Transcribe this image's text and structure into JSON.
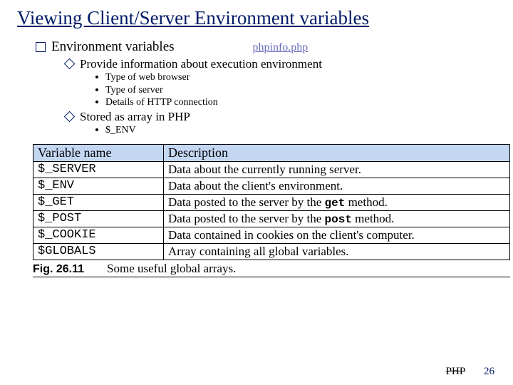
{
  "title": "Viewing Client/Server Environment variables",
  "bullet1": "Environment variables",
  "link": "phpinfo.php",
  "sub1": "Provide information about execution environment",
  "sub1a": "Type of web browser",
  "sub1b": "Type of server",
  "sub1c": "Details of HTTP connection",
  "sub2": "Stored as array in PHP",
  "sub2a": "$_ENV",
  "th1": "Variable name",
  "th2": "Description",
  "rows": [
    {
      "n": "$_SERVER",
      "d": "Data about the currently running server."
    },
    {
      "n": "$_ENV",
      "d": "Data about the client's environment."
    },
    {
      "n": "$_GET",
      "d0": "Data posted to the server by the ",
      "m": "get",
      "d1": " method."
    },
    {
      "n": "$_POST",
      "d0": "Data posted to the server by the ",
      "m": "post",
      "d1": " method."
    },
    {
      "n": "$_COOKIE",
      "d": "Data contained in cookies on the client's computer."
    },
    {
      "n": "$GLOBALS",
      "d": "Array containing all global variables."
    }
  ],
  "cap_label": "Fig. 26.11",
  "cap_text": "Some useful global arrays.",
  "footer_label": "PHP",
  "footer_num": "26"
}
